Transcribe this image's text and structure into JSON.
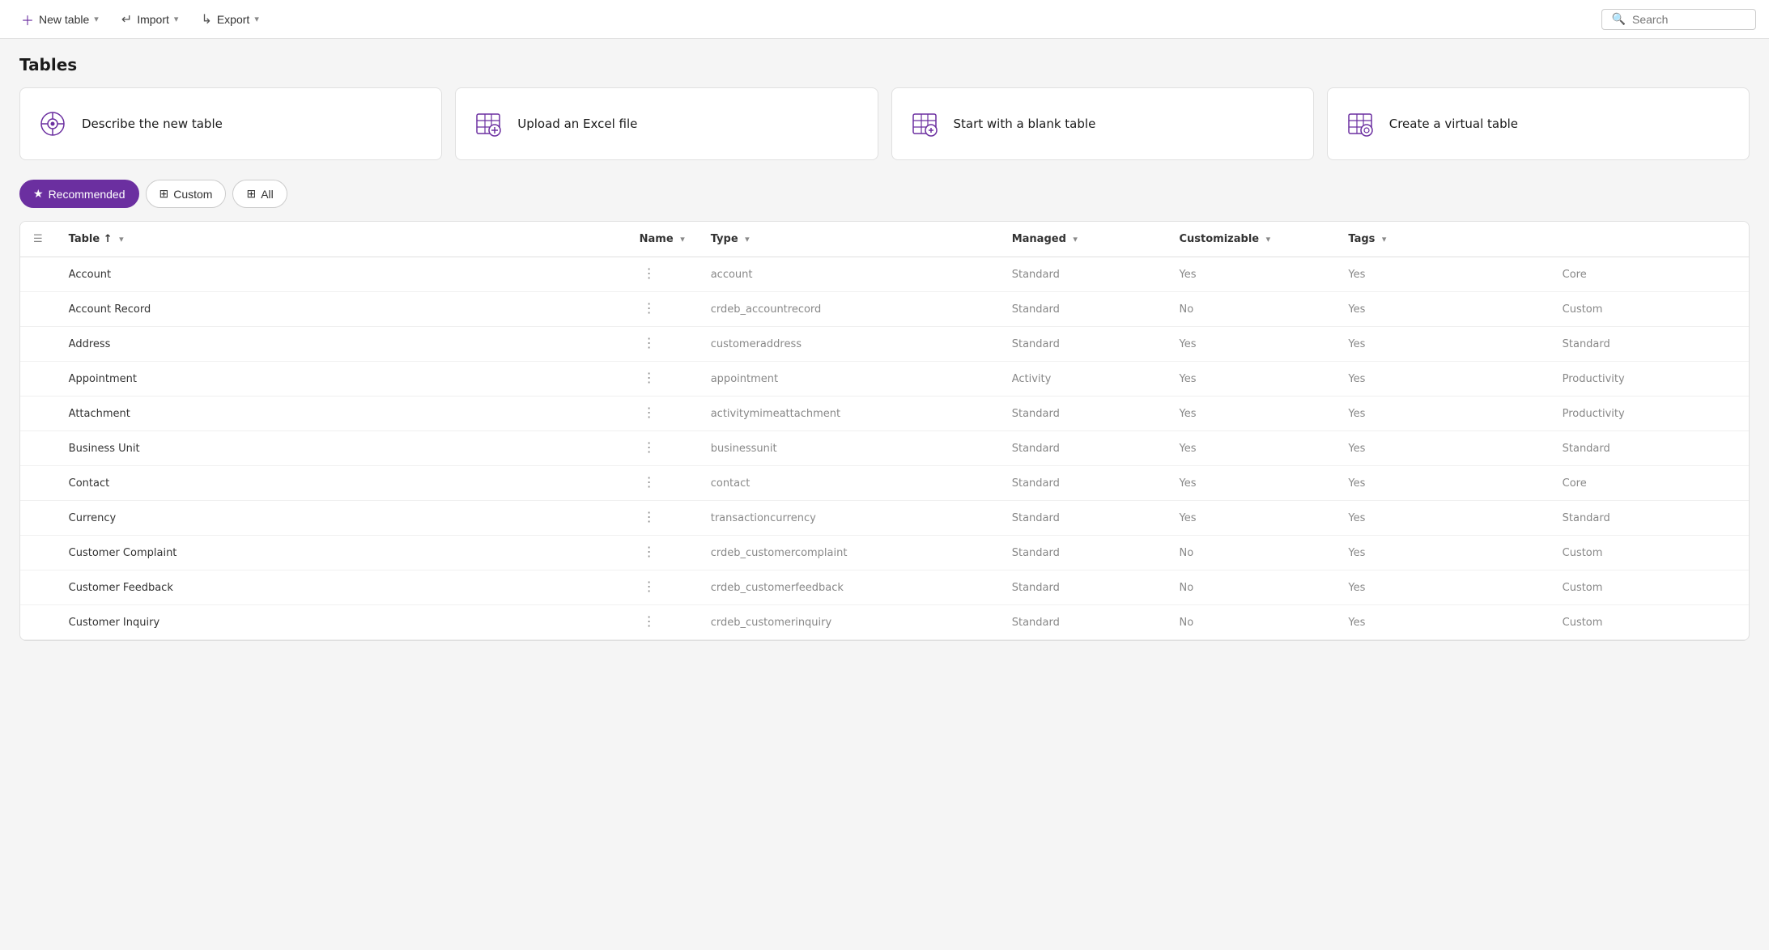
{
  "toolbar": {
    "new_table_label": "New table",
    "import_label": "Import",
    "export_label": "Export",
    "search_placeholder": "Search"
  },
  "page": {
    "title": "Tables"
  },
  "cards": [
    {
      "id": "describe",
      "label": "Describe the new table",
      "icon": "ai"
    },
    {
      "id": "upload",
      "label": "Upload an Excel file",
      "icon": "excel"
    },
    {
      "id": "blank",
      "label": "Start with a blank table",
      "icon": "blank"
    },
    {
      "id": "virtual",
      "label": "Create a virtual table",
      "icon": "virtual"
    }
  ],
  "filters": [
    {
      "id": "recommended",
      "label": "Recommended",
      "icon": "★",
      "active": true
    },
    {
      "id": "custom",
      "label": "Custom",
      "icon": "⊞",
      "active": false
    },
    {
      "id": "all",
      "label": "All",
      "icon": "⊞",
      "active": false
    }
  ],
  "table": {
    "columns": [
      {
        "id": "table",
        "label": "Table",
        "sort": "asc"
      },
      {
        "id": "name",
        "label": "Name",
        "sort": "none"
      },
      {
        "id": "type",
        "label": "Type",
        "sort": "none"
      },
      {
        "id": "managed",
        "label": "Managed",
        "sort": "none"
      },
      {
        "id": "customizable",
        "label": "Customizable",
        "sort": "none"
      },
      {
        "id": "tags",
        "label": "Tags",
        "sort": "none"
      }
    ],
    "rows": [
      {
        "table": "Account",
        "name": "account",
        "type": "Standard",
        "managed": "Yes",
        "customizable": "Yes",
        "tags": "Core"
      },
      {
        "table": "Account Record",
        "name": "crdeb_accountrecord",
        "type": "Standard",
        "managed": "No",
        "customizable": "Yes",
        "tags": "Custom"
      },
      {
        "table": "Address",
        "name": "customeraddress",
        "type": "Standard",
        "managed": "Yes",
        "customizable": "Yes",
        "tags": "Standard"
      },
      {
        "table": "Appointment",
        "name": "appointment",
        "type": "Activity",
        "managed": "Yes",
        "customizable": "Yes",
        "tags": "Productivity"
      },
      {
        "table": "Attachment",
        "name": "activitymimeattachment",
        "type": "Standard",
        "managed": "Yes",
        "customizable": "Yes",
        "tags": "Productivity"
      },
      {
        "table": "Business Unit",
        "name": "businessunit",
        "type": "Standard",
        "managed": "Yes",
        "customizable": "Yes",
        "tags": "Standard"
      },
      {
        "table": "Contact",
        "name": "contact",
        "type": "Standard",
        "managed": "Yes",
        "customizable": "Yes",
        "tags": "Core"
      },
      {
        "table": "Currency",
        "name": "transactioncurrency",
        "type": "Standard",
        "managed": "Yes",
        "customizable": "Yes",
        "tags": "Standard"
      },
      {
        "table": "Customer Complaint",
        "name": "crdeb_customercomplaint",
        "type": "Standard",
        "managed": "No",
        "customizable": "Yes",
        "tags": "Custom"
      },
      {
        "table": "Customer Feedback",
        "name": "crdeb_customerfeedback",
        "type": "Standard",
        "managed": "No",
        "customizable": "Yes",
        "tags": "Custom"
      },
      {
        "table": "Customer Inquiry",
        "name": "crdeb_customerinquiry",
        "type": "Standard",
        "managed": "No",
        "customizable": "Yes",
        "tags": "Custom"
      }
    ]
  }
}
